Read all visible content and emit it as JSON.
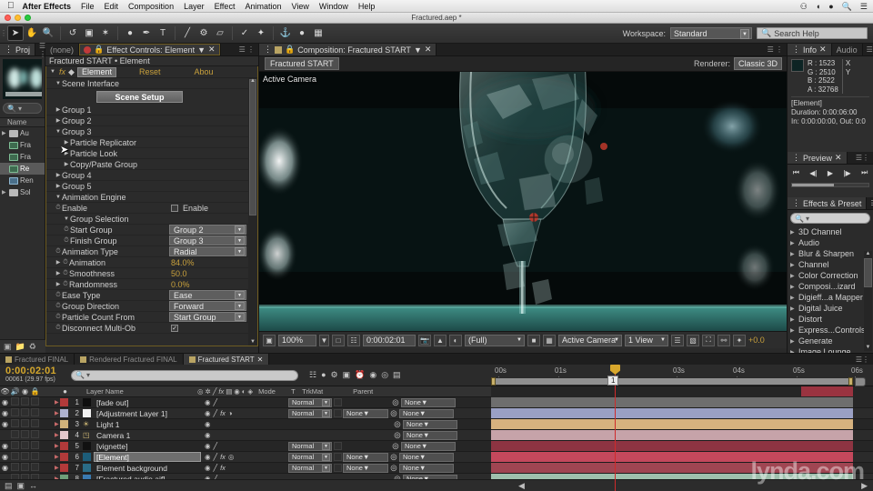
{
  "mac_menu": {
    "apple_icon": "apple-icon",
    "app_name": "After Effects",
    "items": [
      "File",
      "Edit",
      "Composition",
      "Layer",
      "Effect",
      "Animation",
      "View",
      "Window",
      "Help"
    ],
    "status_icons": [
      "dropbox-icon",
      "wifi-icon",
      "user-icon",
      "search-icon",
      "list-icon"
    ]
  },
  "window": {
    "title": "Fractured.aep *"
  },
  "toolbar": {
    "tools": [
      {
        "name": "selection-tool",
        "glyph": "➤",
        "selected": true
      },
      {
        "name": "hand-tool",
        "glyph": "✋",
        "selected": false
      },
      {
        "name": "zoom-tool",
        "glyph": "🔍",
        "selected": false
      },
      {
        "name": "rotation-tool",
        "glyph": "↺",
        "selected": false
      },
      {
        "name": "camera-tool",
        "glyph": "📷",
        "selected": false
      },
      {
        "name": "pan-behind-tool",
        "glyph": "✶",
        "selected": false
      },
      {
        "name": "shape-tool",
        "glyph": "●",
        "selected": false
      },
      {
        "name": "pen-tool",
        "glyph": "✒",
        "selected": false
      },
      {
        "name": "type-tool",
        "glyph": "T",
        "selected": false
      },
      {
        "name": "brush-tool",
        "glyph": "╱",
        "selected": false
      },
      {
        "name": "clone-stamp-tool",
        "glyph": "⚓",
        "selected": false
      },
      {
        "name": "eraser-tool",
        "glyph": "▱",
        "selected": false
      },
      {
        "name": "roto-brush-tool",
        "glyph": "✒",
        "selected": false
      },
      {
        "name": "puppet-pin-tool",
        "glyph": "✦",
        "selected": false
      }
    ],
    "extra_icons": [
      "anchor-icon",
      "dot-icon",
      "grid-icon"
    ],
    "workspace_label": "Workspace:",
    "workspace_value": "Standard",
    "search_help_placeholder": "Search Help"
  },
  "project_panel": {
    "tab_label": "Proj",
    "search_placeholder": "",
    "column_header": "Name",
    "items": [
      {
        "label": "Au",
        "type": "folder",
        "expandable": true,
        "selected": false
      },
      {
        "label": "Fra",
        "type": "comp",
        "expandable": false,
        "selected": false
      },
      {
        "label": "Fra",
        "type": "comp",
        "expandable": false,
        "selected": false
      },
      {
        "label": "Re",
        "type": "comp",
        "expandable": false,
        "selected": true
      },
      {
        "label": "Ren",
        "type": "video",
        "expandable": false,
        "selected": false
      },
      {
        "label": "Sol",
        "type": "folder",
        "expandable": true,
        "selected": false
      }
    ],
    "footer_icons": [
      "new-comp-icon",
      "new-folder-icon",
      "delete-icon"
    ]
  },
  "effect_controls": {
    "tab_label": "Effect Controls: Element",
    "inactive_tab_label": "(none)",
    "breadcrumb": "Fractured START • Element",
    "effect_name": "Element",
    "reset_label": "Reset",
    "about_label": "Abou",
    "scene_interface_label": "Scene Interface",
    "scene_setup_label": "Scene Setup",
    "groups": [
      "Group 1",
      "Group 2",
      "Group 3"
    ],
    "group3_children": [
      "Particle Replicator",
      "Particle Look",
      "Copy/Paste Group"
    ],
    "groups_after": [
      "Group 4",
      "Group 5"
    ],
    "animation_engine_label": "Animation Engine",
    "params": [
      {
        "label": "Enable",
        "value": "Enable",
        "kind": "checkbox",
        "checked": false,
        "indent": 2
      },
      {
        "label": "Group Selection",
        "value": "",
        "kind": "group",
        "indent": 2
      },
      {
        "label": "Start Group",
        "value": "Group 2",
        "kind": "dropdown",
        "indent": 3
      },
      {
        "label": "Finish Group",
        "value": "Group 3",
        "kind": "dropdown",
        "indent": 3
      },
      {
        "label": "Animation Type",
        "value": "Radial",
        "kind": "dropdown",
        "indent": 2
      },
      {
        "label": "Animation",
        "value": "84.0%",
        "kind": "number",
        "indent": 2
      },
      {
        "label": "Smoothness",
        "value": "50.0",
        "kind": "number",
        "indent": 2
      },
      {
        "label": "Randomness",
        "value": "0.0%",
        "kind": "number",
        "indent": 2
      },
      {
        "label": "Ease Type",
        "value": "Ease",
        "kind": "dropdown",
        "indent": 2
      },
      {
        "label": "Group Direction",
        "value": "Forward",
        "kind": "dropdown",
        "indent": 2
      },
      {
        "label": "Particle Count From",
        "value": "Start Group",
        "kind": "dropdown",
        "indent": 2
      },
      {
        "label": "Disconnect Multi-Ob",
        "value": "",
        "kind": "checkbox",
        "checked": true,
        "indent": 2
      }
    ]
  },
  "composition": {
    "tab_label": "Composition: Fractured START",
    "comp_chip": "Fractured START",
    "renderer_label": "Renderer:",
    "renderer_value": "Classic 3D",
    "view_label": "Active Camera",
    "footer": {
      "zoom": "100%",
      "timecode": "0:00:02:01",
      "resolution": "(Full)",
      "camera": "Active Camera",
      "views": "1 View",
      "exposure": "+0.0",
      "icons": [
        "region-of-interest-icon",
        "mask-icon",
        "snapshot-icon",
        "channel-icon",
        "transparency-grid-icon",
        "guides-icon",
        "render-icon",
        "timeline-icon",
        "3d-axis-icon",
        "exposure-icon"
      ]
    }
  },
  "right_sidebar": {
    "info": {
      "tab_label": "Info",
      "audio_tab_label": "Audio",
      "channels": [
        {
          "key": "R",
          "value": "1523"
        },
        {
          "key": "G",
          "value": "2510"
        },
        {
          "key": "B",
          "value": "2522"
        },
        {
          "key": "A",
          "value": "32768"
        }
      ],
      "x_label": "X",
      "y_label": "Y",
      "layer_name": "[Element]",
      "duration": "Duration: 0:00:06:00",
      "inout": "In: 0:00:00:00, Out: 0:0"
    },
    "preview": {
      "tab_label": "Preview",
      "buttons": [
        "first-frame-icon",
        "prev-frame-icon",
        "play-icon",
        "next-frame-icon",
        "last-frame-icon"
      ]
    },
    "effects_presets": {
      "tab_label": "Effects & Preset",
      "search_placeholder": "",
      "categories": [
        "3D Channel",
        "Audio",
        "Blur & Sharpen",
        "Channel",
        "Color Correction",
        "Composi...izard",
        "Digieff...a Mapper",
        "Digital Juice",
        "Distort",
        "Express...Controls",
        "Generate",
        "Image Lounge"
      ]
    }
  },
  "timeline": {
    "tabs": [
      {
        "label": "Fractured FINAL",
        "active": false
      },
      {
        "label": "Rendered Fractured FINAL",
        "active": false
      },
      {
        "label": "Fractured START",
        "active": true
      }
    ],
    "timecode": "0:00:02:01",
    "frame_info": "00061 (29.97 fps)",
    "search_placeholder": "",
    "ruler_ticks": [
      "00s",
      "01s",
      "03s",
      "04s",
      "05s",
      "06s"
    ],
    "cti_label": "1",
    "columns": {
      "layer_name": "Layer Name",
      "mode": "Mode",
      "t": "T",
      "trkmat": "TrkMat",
      "parent": "Parent"
    },
    "switch_icons": [
      "shy-icon",
      "collapse-icon",
      "quality-icon",
      "effects-icon",
      "frame-blend-icon",
      "motion-blur-icon",
      "adjustment-icon",
      "3d-layer-icon"
    ],
    "layers": [
      {
        "num": "1",
        "name": "[fade out]",
        "color": "#b23a3a",
        "swatch": "#0e0e0e",
        "mode": "Normal",
        "trkmat": "",
        "parent": "None",
        "visible": true,
        "selected": false,
        "switches": [
          "audio",
          "transform"
        ],
        "bar": "#6e6e6e",
        "bar_start": 0,
        "bar_end": 100
      },
      {
        "num": "2",
        "name": "[Adjustment Layer 1]",
        "color": "#aeb2cf",
        "swatch": "#f2f2f2",
        "mode": "Normal",
        "trkmat": "None",
        "parent": "None",
        "visible": true,
        "selected": false,
        "switches": [
          "audio",
          "transform",
          "fx",
          "adjust"
        ],
        "bar": "#9aa0c4",
        "bar_start": 0,
        "bar_end": 100
      },
      {
        "num": "3",
        "name": "Light 1",
        "color": "#d0b27a",
        "swatch": "",
        "mode": "",
        "trkmat": "",
        "parent": "None",
        "visible": true,
        "selected": false,
        "switches": [
          "audio"
        ],
        "bar": "#d6b27f",
        "bar_start": 0,
        "bar_end": 100
      },
      {
        "num": "4",
        "name": "Camera 1",
        "color": "#e3c8cc",
        "swatch": "",
        "mode": "",
        "trkmat": "",
        "parent": "None",
        "visible": false,
        "selected": false,
        "switches": [
          "audio"
        ],
        "bar": "#c6a3a9",
        "bar_start": 0,
        "bar_end": 100
      },
      {
        "num": "5",
        "name": "[vignette]",
        "color": "#b23a3a",
        "swatch": "#111111",
        "mode": "Normal",
        "trkmat": "",
        "parent": "None",
        "visible": true,
        "selected": false,
        "switches": [
          "audio",
          "transform"
        ],
        "bar": "#8e3442",
        "bar_start": 0,
        "bar_end": 100
      },
      {
        "num": "6",
        "name": "[Element]",
        "color": "#b23a3a",
        "swatch": "#1d5d79",
        "mode": "Normal",
        "trkmat": "None",
        "parent": "None",
        "visible": true,
        "selected": true,
        "switches": [
          "audio",
          "transform",
          "fx",
          "motion"
        ],
        "bar": "#c4485c",
        "bar_start": 0,
        "bar_end": 100
      },
      {
        "num": "7",
        "name": "Element background",
        "color": "#b23a3a",
        "swatch": "#2a6c87",
        "mode": "Normal",
        "trkmat": "None",
        "parent": "None",
        "visible": true,
        "selected": false,
        "switches": [
          "audio",
          "transform",
          "fx"
        ],
        "bar": "#a04552",
        "bar_start": 0,
        "bar_end": 100
      },
      {
        "num": "8",
        "name": "[Fractured audio.aif]",
        "color": "#6f9f7a",
        "swatch": "#3a7ab0",
        "mode": "",
        "trkmat": "",
        "parent": "None",
        "visible": false,
        "selected": false,
        "switches": [
          "audio",
          "transform"
        ],
        "bar": "#9fc0ad",
        "bar_start": 0,
        "bar_end": 100
      }
    ]
  },
  "watermark": {
    "text": "lynda",
    "suffix": ".com"
  },
  "colors": {
    "accent_gold": "#c8a03c",
    "cti_red": "#cf2b2b",
    "panel_bg": "#2b2b2b",
    "tab_active": "#373737"
  }
}
